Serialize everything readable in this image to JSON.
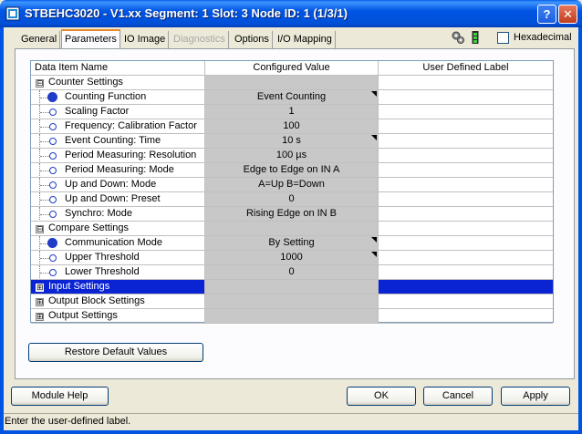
{
  "window": {
    "title": "STBEHC3020 - V1.xx Segment: 1 Slot: 3 Node ID: 1 (1/3/1)",
    "help_glyph": "?",
    "close_glyph": "✕"
  },
  "tabs": [
    {
      "label": "General",
      "state": "normal"
    },
    {
      "label": "Parameters",
      "state": "active"
    },
    {
      "label": "IO Image",
      "state": "normal"
    },
    {
      "label": "Diagnostics",
      "state": "disabled"
    },
    {
      "label": "Options",
      "state": "normal"
    },
    {
      "label": "I/O Mapping",
      "state": "normal"
    }
  ],
  "toolbar": {
    "hexadecimal_label": "Hexadecimal",
    "hexadecimal_checked": false
  },
  "grid": {
    "headers": [
      "Data Item Name",
      "Configured Value",
      "User Defined Label"
    ],
    "rows": [
      {
        "type": "group",
        "expander": "⊟",
        "name": "Counter Settings",
        "value": "",
        "label": ""
      },
      {
        "type": "item",
        "marker": "filled",
        "name": "Counting Function",
        "value": "Event Counting",
        "label": "",
        "editable": true
      },
      {
        "type": "item",
        "marker": "hollow",
        "name": "Scaling Factor",
        "value": "1",
        "label": ""
      },
      {
        "type": "item",
        "marker": "hollow",
        "name": "Frequency: Calibration Factor",
        "value": "100",
        "label": ""
      },
      {
        "type": "item",
        "marker": "hollow",
        "name": "Event Counting: Time",
        "value": "10 s",
        "label": "",
        "editable": true
      },
      {
        "type": "item",
        "marker": "hollow",
        "name": "Period Measuring: Resolution",
        "value": "100 µs",
        "label": ""
      },
      {
        "type": "item",
        "marker": "hollow",
        "name": "Period Measuring: Mode",
        "value": "Edge to Edge on IN A",
        "label": ""
      },
      {
        "type": "item",
        "marker": "hollow",
        "name": "Up and Down: Mode",
        "value": "A=Up B=Down",
        "label": ""
      },
      {
        "type": "item",
        "marker": "hollow",
        "name": "Up and Down: Preset",
        "value": "0",
        "label": ""
      },
      {
        "type": "item",
        "marker": "hollow",
        "name": "Synchro: Mode",
        "value": "Rising Edge on IN B",
        "label": ""
      },
      {
        "type": "group",
        "expander": "⊟",
        "name": "Compare Settings",
        "value": "",
        "label": ""
      },
      {
        "type": "item",
        "marker": "filled",
        "name": "Communication Mode",
        "value": "By Setting",
        "label": "",
        "editable": true
      },
      {
        "type": "item",
        "marker": "hollow",
        "name": "Upper Threshold",
        "value": "1000",
        "label": "",
        "editable": true
      },
      {
        "type": "item",
        "marker": "hollow",
        "name": "Lower Threshold",
        "value": "0",
        "label": ""
      },
      {
        "type": "group",
        "expander": "⊞",
        "name": "Input Settings",
        "value": "",
        "label": "",
        "selected": true
      },
      {
        "type": "group",
        "expander": "⊞",
        "name": "Output Block Settings",
        "value": "",
        "label": ""
      },
      {
        "type": "group",
        "expander": "⊞",
        "name": "Output Settings",
        "value": "",
        "label": ""
      }
    ]
  },
  "buttons": {
    "restore": "Restore Default Values",
    "module_help": "Module Help",
    "ok": "OK",
    "cancel": "Cancel",
    "apply": "Apply"
  },
  "status": {
    "text": "Enter the user-defined label."
  },
  "colors": {
    "titlebar": "#0054e3",
    "selection": "#0a24d4",
    "configured_cell": "#c8c8c8",
    "active_tab_accent": "#e68b2c"
  }
}
